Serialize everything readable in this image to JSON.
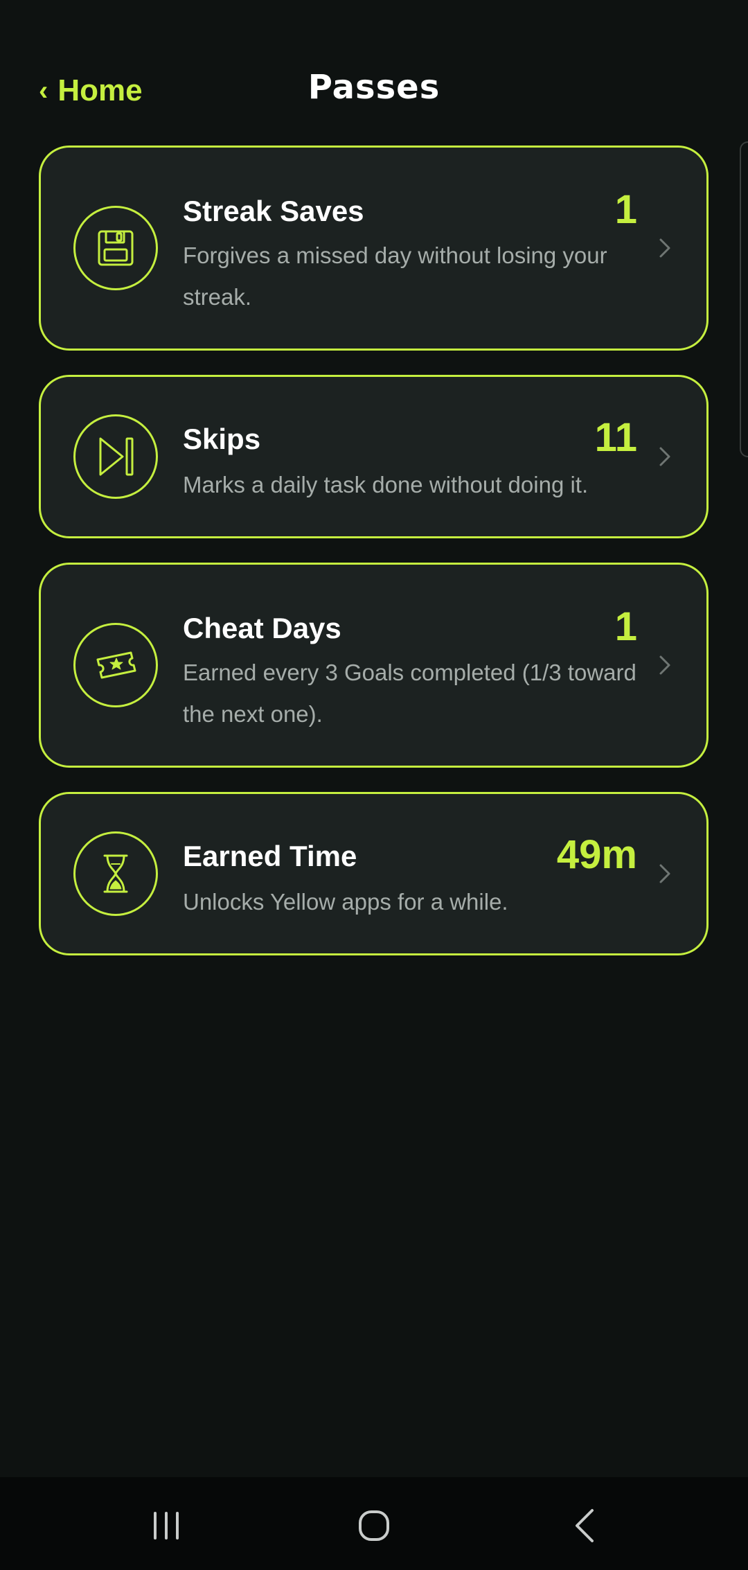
{
  "header": {
    "back_label": "Home",
    "back_chevron": "‹",
    "title": "Passes"
  },
  "passes": [
    {
      "title": "Streak Saves",
      "description": "Forgives a missed day without losing your streak.",
      "count": "1",
      "icon": "floppy-disk-icon"
    },
    {
      "title": "Skips",
      "description": "Marks a daily task done without doing it.",
      "count": "11",
      "icon": "skip-forward-icon"
    },
    {
      "title": "Cheat Days",
      "description": "Earned every 3 Goals completed (1/3 toward the next one).",
      "count": "1",
      "icon": "ticket-star-icon"
    },
    {
      "title": "Earned Time",
      "description": "Unlocks Yellow apps for a while.",
      "count": "49m",
      "icon": "hourglass-icon"
    }
  ],
  "colors": {
    "accent": "#c5ef3f",
    "background": "#0e1211",
    "card": "#1c2221",
    "muted_text": "#a6adaa"
  },
  "system_nav": {
    "recents_icon": "recents-icon",
    "home_icon": "home-icon",
    "back_icon": "back-icon"
  }
}
